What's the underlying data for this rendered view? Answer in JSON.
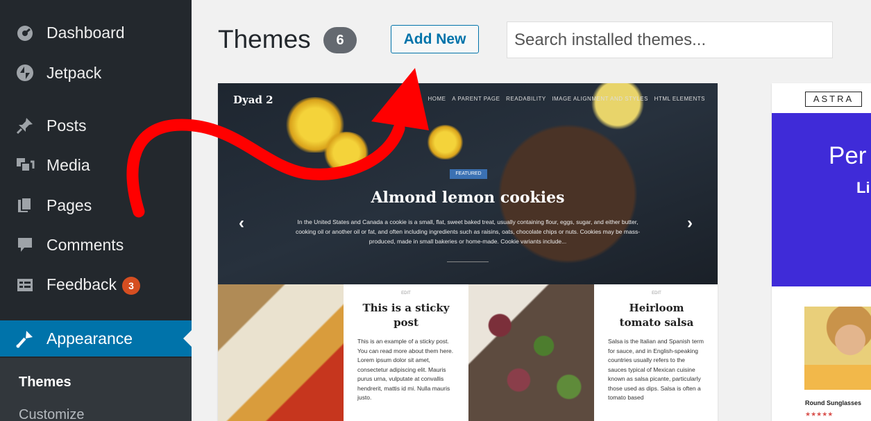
{
  "sidebar": {
    "items": [
      {
        "label": "Dashboard",
        "icon": "dashboard-icon"
      },
      {
        "label": "Jetpack",
        "icon": "jetpack-icon"
      },
      {
        "label": "Posts",
        "icon": "pin-icon"
      },
      {
        "label": "Media",
        "icon": "media-icon"
      },
      {
        "label": "Pages",
        "icon": "pages-icon"
      },
      {
        "label": "Comments",
        "icon": "comment-icon"
      },
      {
        "label": "Feedback",
        "icon": "feedback-icon",
        "badge": "3"
      },
      {
        "label": "Appearance",
        "icon": "brush-icon",
        "active": true
      }
    ],
    "submenu": {
      "current": "Themes",
      "other": "Customize"
    }
  },
  "header": {
    "title": "Themes",
    "count": "6",
    "add_new_label": "Add New",
    "search_placeholder": "Search installed themes..."
  },
  "theme_preview": {
    "site_title": "Dyad 2",
    "nav": [
      "HOME",
      "A PARENT PAGE",
      "READABILITY",
      "IMAGE ALIGNMENT AND STYLES",
      "HTML ELEMENTS"
    ],
    "featured_label": "FEATURED",
    "hero_title": "Almond lemon cookies",
    "hero_text": "In the United States and Canada a cookie is a small, flat, sweet baked treat, usually containing flour, eggs, sugar, and either butter, cooking oil or another oil or fat, and often including ingredients such as raisins, oats, chocolate chips or nuts. Cookies may be mass-produced, made in small bakeries or home-made. Cookie variants include...",
    "prev_arrow": "‹",
    "next_arrow": "›",
    "posts": [
      {
        "edit": "EDIT",
        "title": "This is a sticky post",
        "body": "This is an example of a sticky post. You can read more about them here. Lorem ipsum dolor sit amet, consectetur adipiscing elit. Mauris purus urna, vulputate at convallis hendrerit, mattis id mi. Nulla mauris justo."
      },
      {
        "edit": "EDIT",
        "title": "Heirloom tomato salsa",
        "body": "Salsa is the Italian and Spanish term for sauce, and in English-speaking countries usually refers to the sauces typical of Mexican cuisine known as salsa picante, particularly those used as dips. Salsa is often a tomato based"
      }
    ]
  },
  "astra": {
    "logo": "ASTRA",
    "hero_line1": "Per",
    "hero_line2": "Li",
    "caption": "Round Sunglasses",
    "stars": "★★★★★"
  },
  "colors": {
    "sidebar_bg": "#23282d",
    "active_bg": "#0073aa",
    "badge": "#d54e21",
    "arrow": "#ff0000"
  }
}
